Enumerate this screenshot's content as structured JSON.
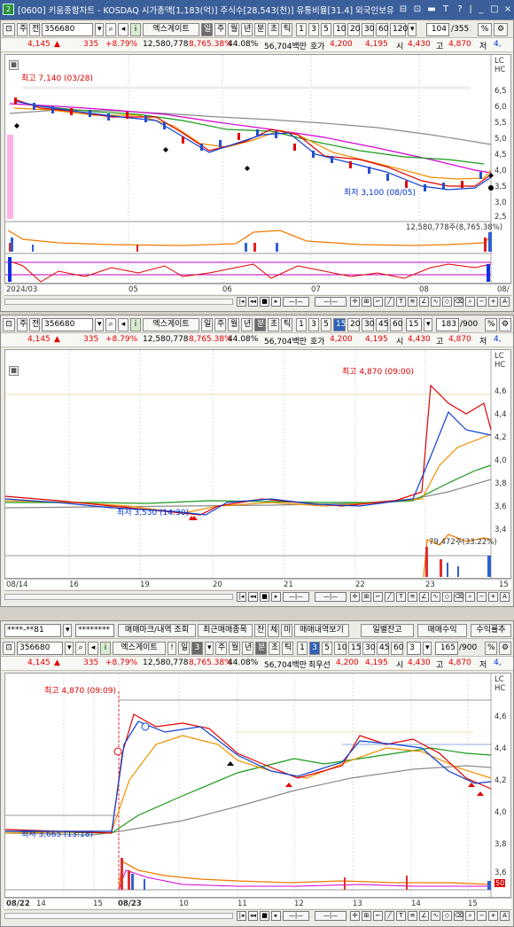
{
  "window": {
    "app_icon": "2",
    "title": "[0600] 키움종합차트 - KOSDAQ 시가총액[1,183(억)] 주식수[28,543(천)] 유통비율[31.4] 외국인보유",
    "buttons": [
      "⊟",
      "⊡",
      "▬",
      "T",
      "?",
      "|",
      "_",
      "□",
      "×"
    ]
  },
  "quote": {
    "price": "4,145",
    "arrow": "▲",
    "change": "335",
    "rate": "+8.79%",
    "volume": "12,580,778",
    "vol_rate": "8,765.38%",
    "turnover": "44.08%",
    "amount": "56,704백만",
    "ask_label": "호가",
    "ask_label_3": "최우선",
    "ask": "4,200",
    "bid": "4,195",
    "open_label": "시",
    "open": "4,430",
    "high_label": "고",
    "high": "4,870",
    "low_label": "저",
    "low": "4,"
  },
  "panel1": {
    "code": "356680",
    "name": "엑스게이트",
    "period_buttons": [
      "일",
      "주",
      "월",
      "년",
      "분",
      "초",
      "틱"
    ],
    "active_period": "일",
    "intervals": [
      "1",
      "3",
      "5",
      "10",
      "20",
      "30",
      "60",
      "120"
    ],
    "count": "104",
    "total": "/355",
    "high_annot": "최고 7,140 (03/28)",
    "low_annot": "최저 3,100 (08/05)",
    "vol_annot": "12,580,778주(8,765.38%)",
    "price_ticks": [
      "6,5",
      "6,0",
      "5,5",
      "5,0",
      "4,5",
      "4,0",
      "3,5",
      "3,0",
      "2,5"
    ],
    "dates": [
      "2024/03",
      "05",
      "06",
      "07",
      "08",
      "08/"
    ],
    "side_labels": [
      "LC",
      "HC"
    ]
  },
  "panel2": {
    "code": "356680",
    "name": "엑스게이트",
    "period_buttons": [
      "일",
      "주",
      "월",
      "년",
      "분",
      "초",
      "틱"
    ],
    "active_period": "분",
    "intervals": [
      "1",
      "3",
      "5",
      "15",
      "20",
      "30",
      "45",
      "60"
    ],
    "interval_sel": "15",
    "count": "183",
    "total": "/900",
    "high_annot": "최고 4,870 (09:00)",
    "low_annot": "최저 3,530 (14:30)",
    "vol_annot": "79,472주(33.22%)",
    "price_ticks": [
      "4,6",
      "4,4",
      "4,2",
      "4,0",
      "3,8",
      "3,6",
      "3,4"
    ],
    "dates": [
      "08/14",
      "16",
      "19",
      "20",
      "21",
      "22",
      "23",
      "15"
    ],
    "side_labels": [
      "LC",
      "HC"
    ]
  },
  "panel3": {
    "top_input": "****-**81",
    "password": "********",
    "tabs": [
      "매매마크/내역 조회",
      "최근매매종목",
      "잔",
      "체",
      "미",
      "매매내역보기",
      "일별잔고",
      "매매수익",
      "수익률추"
    ],
    "code": "356680",
    "name": "엑스게이트",
    "period_buttons": [
      "!",
      "일",
      "3",
      "주",
      "월",
      "년",
      "분",
      "초",
      "틱"
    ],
    "active_period": "분",
    "intervals": [
      "1",
      "3",
      "5",
      "10",
      "15",
      "30",
      "45",
      "60"
    ],
    "interval_sel": "3",
    "count": "165",
    "total": "/900",
    "high_annot": "최고 4,870 (09:09)",
    "low_annot": "최저 3,665 (13:18)",
    "price_ticks": [
      "4,6",
      "4,4",
      "4,2",
      "4,0",
      "3,8",
      "3,6"
    ],
    "dates": [
      "08/22",
      "14",
      "15",
      "08/23",
      "10",
      "11",
      "12",
      "13",
      "14",
      "15"
    ],
    "side_labels": [
      "LC",
      "HC"
    ],
    "pos_label": "50"
  }
}
